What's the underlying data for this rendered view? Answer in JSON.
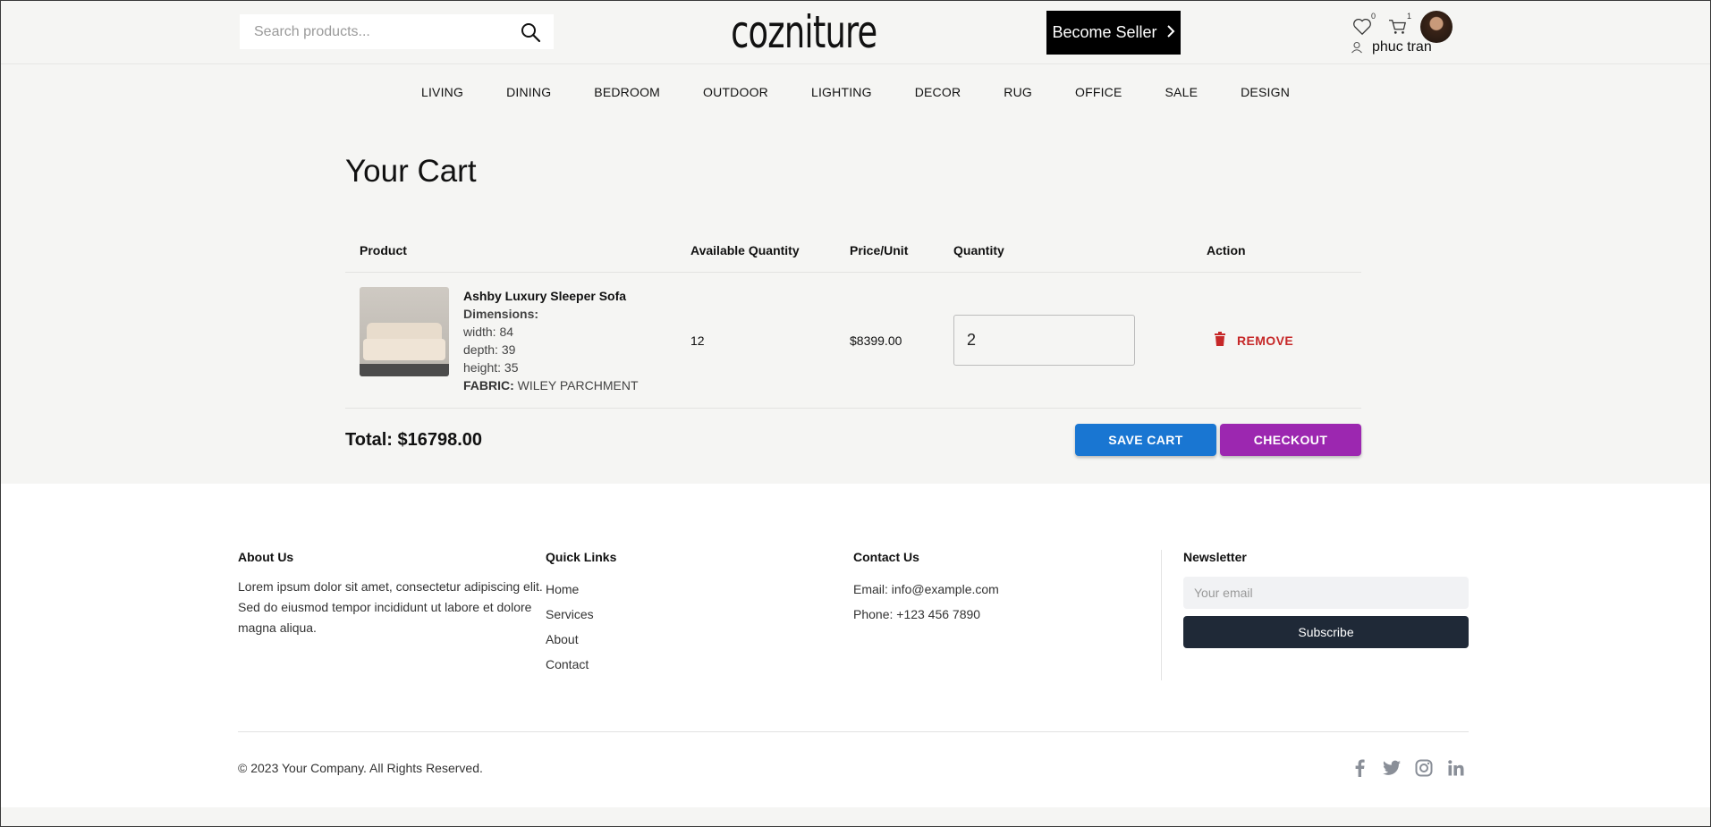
{
  "header": {
    "search_placeholder": "Search products...",
    "logo": "cozniture",
    "seller_label": "Become Seller",
    "wishlist_count": "0",
    "cart_count": "1",
    "username": "phuc tran"
  },
  "nav": [
    "LIVING",
    "DINING",
    "BEDROOM",
    "OUTDOOR",
    "LIGHTING",
    "DECOR",
    "RUG",
    "OFFICE",
    "SALE",
    "DESIGN"
  ],
  "cart": {
    "title": "Your Cart",
    "columns": {
      "product": "Product",
      "available": "Available Quantity",
      "price": "Price/Unit",
      "quantity": "Quantity",
      "action": "Action"
    },
    "items": [
      {
        "name": "Ashby Luxury Sleeper Sofa",
        "dimensions_label": "Dimensions:",
        "width": "width: 84",
        "depth": "depth: 39",
        "height": "height: 35",
        "fabric_label": "FABRIC:",
        "fabric_value": "WILEY PARCHMENT",
        "available": "12",
        "price": "$8399.00",
        "quantity": "2",
        "remove_label": "REMOVE"
      }
    ],
    "total": "Total: $16798.00",
    "save_label": "SAVE CART",
    "checkout_label": "CHECKOUT"
  },
  "footer": {
    "about_title": "About Us",
    "about_text": "Lorem ipsum dolor sit amet, consectetur adipiscing elit. Sed do eiusmod tempor incididunt ut labore et dolore magna aliqua.",
    "links_title": "Quick Links",
    "links": [
      "Home",
      "Services",
      "About",
      "Contact"
    ],
    "contact_title": "Contact Us",
    "email": "Email: info@example.com",
    "phone": "Phone: +123 456 7890",
    "newsletter_title": "Newsletter",
    "newsletter_placeholder": "Your email",
    "subscribe_label": "Subscribe",
    "copyright": "© 2023 Your Company. All Rights Reserved.",
    "social_icons": [
      "facebook-icon",
      "twitter-icon",
      "instagram-icon",
      "linkedin-icon"
    ]
  },
  "colors": {
    "save": "#1976d2",
    "checkout": "#9c27b0",
    "remove": "#c62828",
    "subscribe": "#1f2937"
  }
}
